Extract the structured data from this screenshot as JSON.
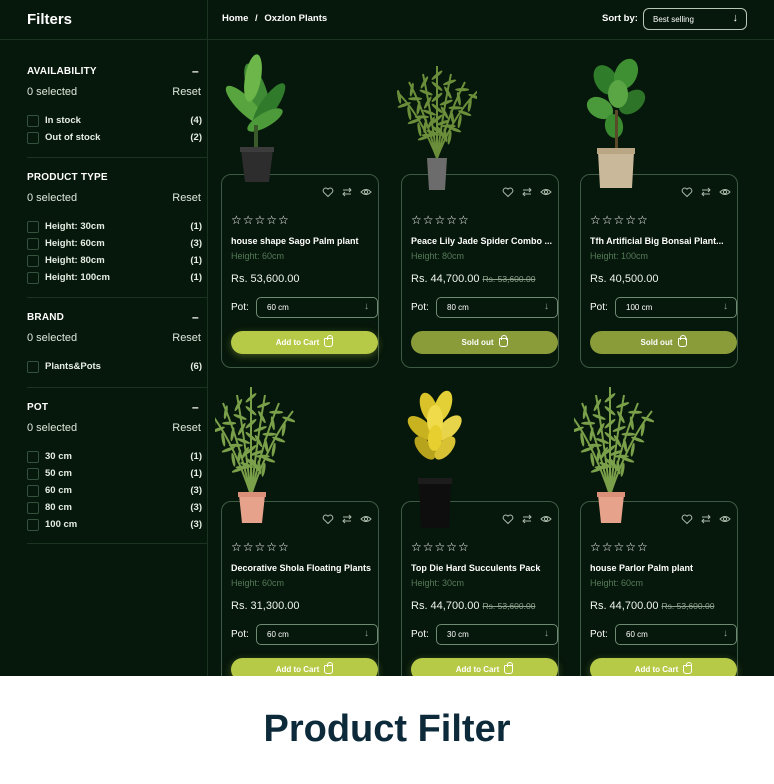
{
  "sidebar": {
    "title": "Filters",
    "sections": [
      {
        "heading": "AVAILABILITY",
        "selected": "0 selected",
        "reset": "Reset",
        "options": [
          {
            "label": "In stock",
            "count": "(4)"
          },
          {
            "label": "Out of stock",
            "count": "(2)"
          }
        ]
      },
      {
        "heading": "PRODUCT TYPE",
        "selected": "0 selected",
        "reset": "Reset",
        "options": [
          {
            "label": "Height: 30cm",
            "count": "(1)"
          },
          {
            "label": "Height: 60cm",
            "count": "(3)"
          },
          {
            "label": "Height: 80cm",
            "count": "(1)"
          },
          {
            "label": "Height: 100cm",
            "count": "(1)"
          }
        ]
      },
      {
        "heading": "BRAND",
        "selected": "0 selected",
        "reset": "Reset",
        "options": [
          {
            "label": "Plants&Pots",
            "count": "(6)"
          }
        ]
      },
      {
        "heading": "POT",
        "selected": "0 selected",
        "reset": "Reset",
        "options": [
          {
            "label": "30 cm",
            "count": "(1)"
          },
          {
            "label": "50 cm",
            "count": "(1)"
          },
          {
            "label": "60 cm",
            "count": "(3)"
          },
          {
            "label": "80 cm",
            "count": "(3)"
          },
          {
            "label": "100 cm",
            "count": "(3)"
          }
        ]
      }
    ],
    "collapse_symbol": "–"
  },
  "topbar": {
    "breadcrumb": [
      "Home",
      "/",
      "Oxzlon Plants"
    ],
    "sort_label": "Sort by:",
    "sort_value": "Best selling",
    "sort_arrow": "↓"
  },
  "products": [
    {
      "name": "house shape Sago Palm plant",
      "height": "Height: 60cm",
      "price": "Rs. 53,600.00",
      "old_price": "",
      "pot_label": "Pot:",
      "pot": "60 cm",
      "button": "Add to Cart",
      "sold_out": false,
      "stars": "☆☆☆☆☆"
    },
    {
      "name": "Peace Lily Jade Spider Combo ...",
      "height": "Height: 80cm",
      "price": "Rs. 44,700.00",
      "old_price": "Rs. 53,600.00",
      "pot_label": "Pot:",
      "pot": "80 cm",
      "button": "Sold out",
      "sold_out": true,
      "stars": "☆☆☆☆☆"
    },
    {
      "name": "Tfh Artificial Big Bonsai Plant...",
      "height": "Height: 100cm",
      "price": "Rs. 40,500.00",
      "old_price": "",
      "pot_label": "Pot:",
      "pot": "100 cm",
      "button": "Sold out",
      "sold_out": true,
      "stars": "☆☆☆☆☆"
    },
    {
      "name": "Decorative Shola Floating Plants",
      "height": "Height: 60cm",
      "price": "Rs. 31,300.00",
      "old_price": "",
      "pot_label": "Pot:",
      "pot": "60 cm",
      "button": "Add to Cart",
      "sold_out": false,
      "stars": "☆☆☆☆☆"
    },
    {
      "name": "Top Die Hard Succulents Pack",
      "height": "Height: 30cm",
      "price": "Rs. 44,700.00",
      "old_price": "Rs. 53,600.00",
      "pot_label": "Pot:",
      "pot": "30 cm",
      "button": "Add to Cart",
      "sold_out": false,
      "stars": "☆☆☆☆☆"
    },
    {
      "name": "house Parlor Palm plant",
      "height": "Height: 60cm",
      "price": "Rs. 44,700.00",
      "old_price": "Rs. 53,600.00",
      "pot_label": "Pot:",
      "pot": "60 cm",
      "button": "Add to Cart",
      "sold_out": false,
      "stars": "☆☆☆☆☆"
    }
  ],
  "pot_arrow": "↓",
  "caption": "Product Filter",
  "colors": {
    "background": "#06170b",
    "accent": "#b7ca47",
    "sold_out": "#8a9c3a",
    "caption": "#0d2a3a"
  }
}
